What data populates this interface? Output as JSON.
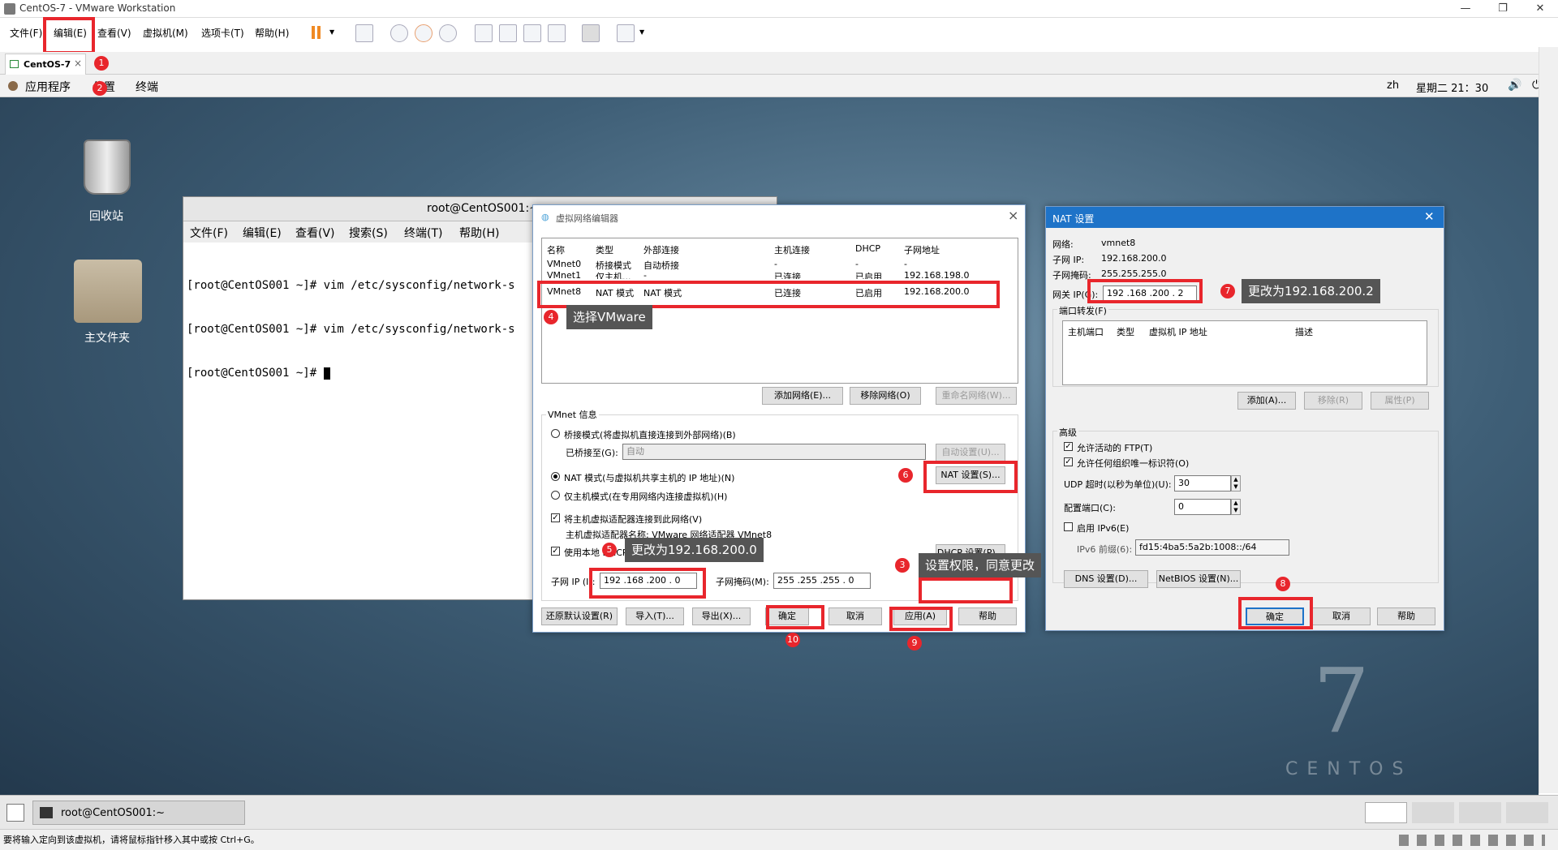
{
  "window": {
    "title": "CentOS-7 - VMware Workstation",
    "min": "—",
    "max": "❐",
    "close": "✕"
  },
  "menu": {
    "file": "文件(F)",
    "edit": "编辑(E)",
    "view": "查看(V)",
    "vm": "虚拟机(M)",
    "tabs": "选项卡(T)",
    "help": "帮助(H)"
  },
  "tab": {
    "label": "CentOS-7",
    "close": "×"
  },
  "gnome": {
    "apps": "应用程序",
    "places": "位置",
    "terminal": "终端",
    "lang": "zh",
    "clock": "星期二 21：30"
  },
  "desktop": {
    "trash": "回收站",
    "home": "主文件夹",
    "centos_num": "7",
    "centos_text": "CENTOS"
  },
  "terminal": {
    "title": "root@CentOS001:~",
    "menu": [
      "文件(F)",
      "编辑(E)",
      "查看(V)",
      "搜索(S)",
      "终端(T)",
      "帮助(H)"
    ],
    "lines": [
      "[root@CentOS001 ~]# vim /etc/sysconfig/network-s",
      "[root@CentOS001 ~]# vim /etc/sysconfig/network-s",
      "[root@CentOS001 ~]# "
    ]
  },
  "vne": {
    "title": "虚拟网络编辑器",
    "cols": [
      "名称",
      "类型",
      "外部连接",
      "主机连接",
      "DHCP",
      "子网地址"
    ],
    "rows": [
      [
        "VMnet0",
        "桥接模式",
        "自动桥接",
        "-",
        "-",
        "-"
      ],
      [
        "VMnet1",
        "仅主机...",
        "-",
        "已连接",
        "已启用",
        "192.168.198.0"
      ],
      [
        "VMnet8",
        "NAT 模式",
        "NAT 模式",
        "已连接",
        "已启用",
        "192.168.200.0"
      ]
    ],
    "add": "添加网络(E)...",
    "remove": "移除网络(O)",
    "rename": "重命名网络(W)...",
    "info": "VMnet 信息",
    "bridge": "桥接模式(将虚拟机直接连接到外部网络)(B)",
    "bridged_to": "已桥接至(G):",
    "auto": "自动",
    "auto_set": "自动设置(U)...",
    "nat": "NAT 模式(与虚拟机共享主机的 IP 地址)(N)",
    "nat_set": "NAT 设置(S)...",
    "hostonly": "仅主机模式(在专用网络内连接虚拟机)(H)",
    "connect": "将主机虚拟适配器连接到此网络(V)",
    "adapter": "主机虚拟适配器名称: VMware 网络适配器 VMnet8",
    "dhcp": "使用本地 DHCP 服务将 IP 地址分配给虚拟机(D)",
    "dhcp_set": "DHCP 设置(P)...",
    "subnet_ip_lbl": "子网 IP (I):",
    "subnet_ip": "192 .168 .200 .  0",
    "mask_lbl": "子网掩码(M):",
    "mask": "255 .255 .255 .  0",
    "restore": "还原默认设置(R)",
    "import": "导入(T)...",
    "export": "导出(X)...",
    "ok": "确定",
    "cancel": "取消",
    "apply": "应用(A)",
    "help": "帮助"
  },
  "nat": {
    "title": "NAT 设置",
    "net_lbl": "网络:",
    "net": "vmnet8",
    "sip_lbl": "子网 IP:",
    "sip": "192.168.200.0",
    "smask_lbl": "子网掩码:",
    "smask": "255.255.255.0",
    "gw_lbl": "网关 IP(G):",
    "gw": "192 .168 .200 .  2",
    "pf": "端口转发(F)",
    "pf_cols": [
      "主机端口",
      "类型",
      "虚拟机 IP 地址",
      "描述"
    ],
    "add": "添加(A)...",
    "remove": "移除(R)",
    "props": "属性(P)",
    "adv": "高级",
    "ftp": "允许活动的 FTP(T)",
    "oui": "允许任何组织唯一标识符(O)",
    "udp_lbl": "UDP 超时(以秒为单位)(U):",
    "udp": "30",
    "cfg_lbl": "配置端口(C):",
    "cfg": "0",
    "ipv6": "启用 IPv6(E)",
    "prefix_lbl": "IPv6 前缀(6):",
    "prefix": "fd15:4ba5:5a2b:1008::/64",
    "dns": "DNS 设置(D)...",
    "netbios": "NetBIOS 设置(N)...",
    "ok": "确定",
    "cancel": "取消",
    "help": "帮助"
  },
  "anno": {
    "n1": "1",
    "n2": "2",
    "n3": "3",
    "n4": "4",
    "n5": "5",
    "n6": "6",
    "n7": "7",
    "n8": "8",
    "n9": "9",
    "n10": "10",
    "t4": "选择VMware",
    "t5": "更改为192.168.200.0",
    "t3": "设置权限，同意更改",
    "t7": "更改为192.168.200.2"
  },
  "taskbar": {
    "item": "root@CentOS001:~"
  },
  "status": {
    "text": "要将输入定向到该虚拟机，请将鼠标指针移入其中或按 Ctrl+G。"
  }
}
